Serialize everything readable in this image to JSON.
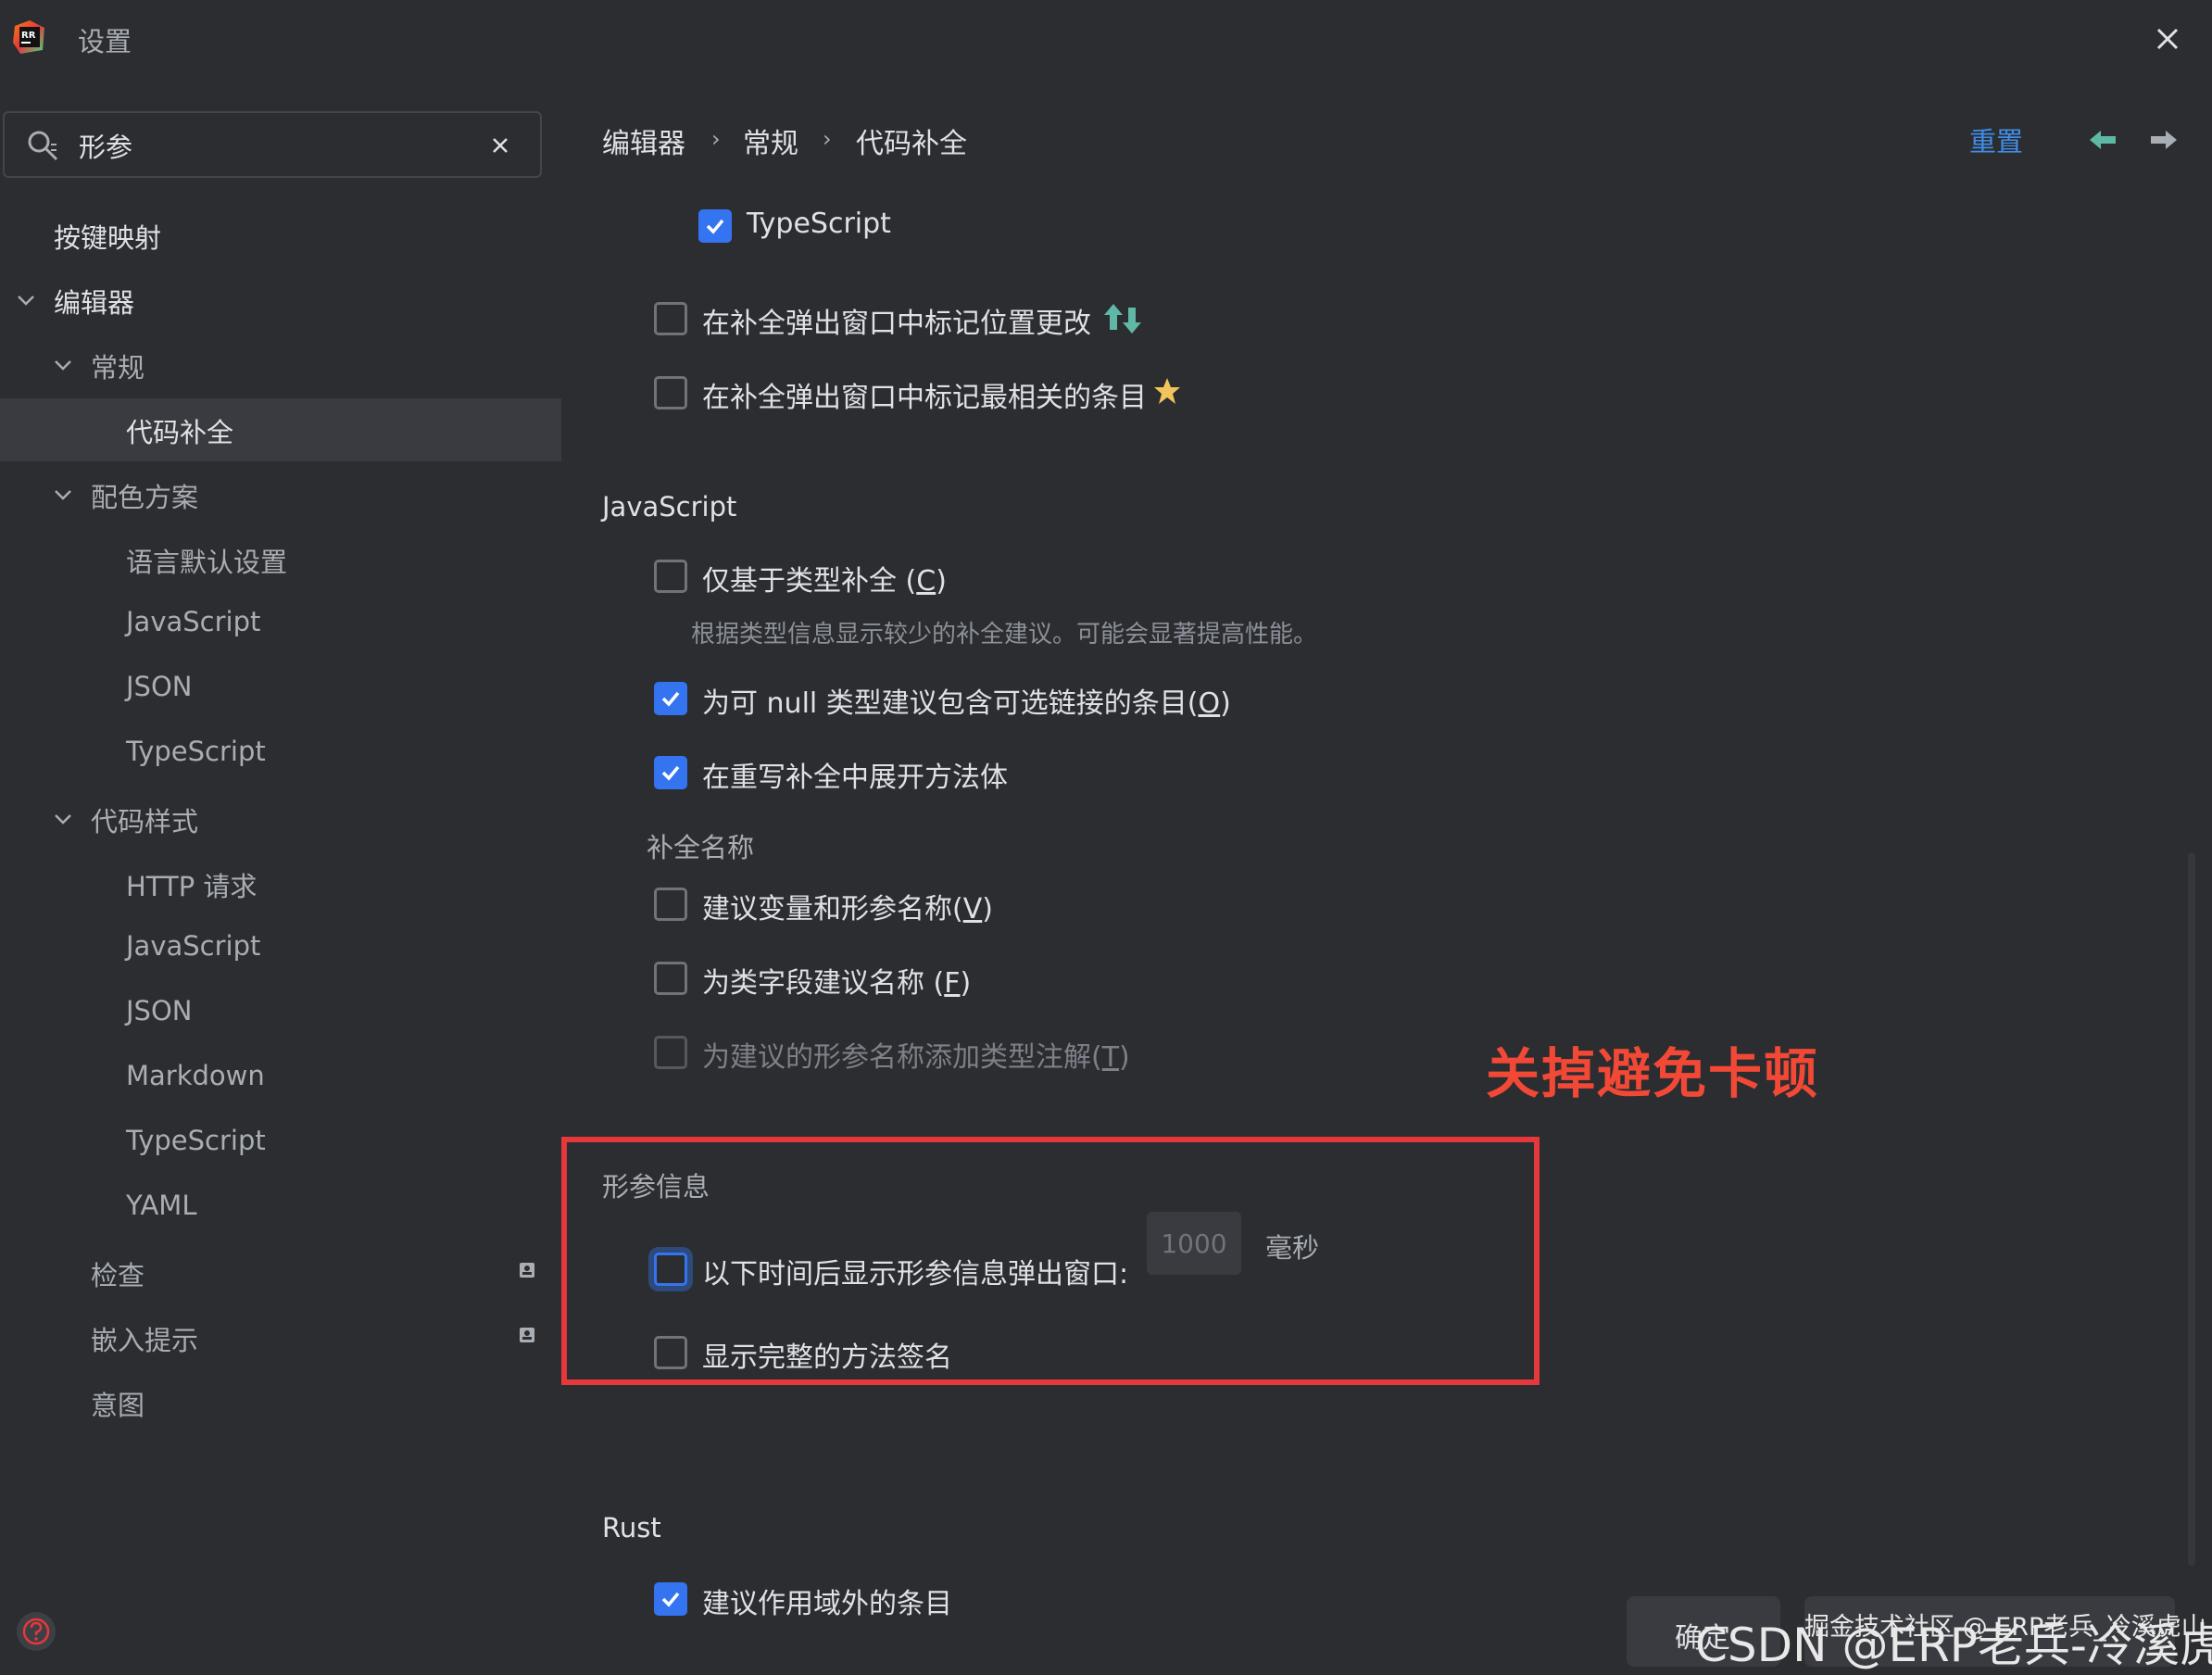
{
  "window": {
    "title": "设置"
  },
  "search": {
    "value": "形参"
  },
  "sidebar": {
    "items": [
      {
        "label": "按键映射"
      },
      {
        "label": "编辑器"
      },
      {
        "label": "常规"
      },
      {
        "label": "代码补全"
      },
      {
        "label": "配色方案"
      },
      {
        "label": "语言默认设置"
      },
      {
        "label": "JavaScript"
      },
      {
        "label": "JSON"
      },
      {
        "label": "TypeScript"
      },
      {
        "label": "代码样式"
      },
      {
        "label": "HTTP 请求"
      },
      {
        "label": "JavaScript"
      },
      {
        "label": "JSON"
      },
      {
        "label": "Markdown"
      },
      {
        "label": "TypeScript"
      },
      {
        "label": "YAML"
      },
      {
        "label": "检查"
      },
      {
        "label": "嵌入提示"
      },
      {
        "label": "意图"
      }
    ]
  },
  "breadcrumb": {
    "items": [
      "编辑器",
      "常规",
      "代码补全"
    ]
  },
  "header": {
    "reset_label": "重置"
  },
  "settings": {
    "typescript_cb": {
      "label": "TypeScript",
      "checked": true
    },
    "mark_position_cb": {
      "label": "在补全弹出窗口中标记位置更改",
      "checked": false
    },
    "mark_relevant_cb": {
      "label": "在补全弹出窗口中标记最相关的条目",
      "checked": false
    },
    "javascript_section": "JavaScript",
    "type_based": {
      "label": "仅基于类型补全 (",
      "mnemonic": "C",
      "suffix": ")",
      "checked": false
    },
    "type_based_hint": "根据类型信息显示较少的补全建议。可能会显著提高性能。",
    "nullable": {
      "label_a": "为可 ",
      "label_null": "null",
      "label_b": " 类型建议包含可选链接的条目(",
      "mnemonic": "O",
      "suffix": ")",
      "checked": true
    },
    "expand_method": {
      "label": "在重写补全中展开方法体",
      "checked": true
    },
    "completion_names_section": "补全名称",
    "suggest_var": {
      "label": "建议变量和形参名称(",
      "mnemonic": "V",
      "suffix": ")",
      "checked": false
    },
    "suggest_field": {
      "label": "为类字段建议名称 (",
      "mnemonic": "F",
      "suffix": ")",
      "checked": false
    },
    "add_type_annot": {
      "label": "为建议的形参名称添加类型注解(",
      "mnemonic": "T",
      "suffix": ")",
      "checked": false,
      "disabled": true
    },
    "param_info_section": "形参信息",
    "show_param_popup": {
      "label": "以下时间后显示形参信息弹出窗口:",
      "checked": false,
      "delay_value": "1000",
      "unit": "毫秒"
    },
    "full_signature": {
      "label": "显示完整的方法签名",
      "checked": false
    },
    "rust_section": "Rust",
    "rust_out_of_scope": {
      "label": "建议作用域外的条目",
      "checked": true
    }
  },
  "annotation": {
    "text": "关掉避免卡顿",
    "color": "#e5383b"
  },
  "footer": {
    "ok_label": "确定"
  },
  "watermarks": {
    "csdn": "CSDN @ERP老兵-冷溪虎山",
    "juejin": "掘金技术社区 @ ERP老兵_冷溪虎山",
    "bg": "ERP老兵-冷溪虎山"
  },
  "colors": {
    "accent": "#3574f0",
    "background": "#2b2d30",
    "selection": "#393b40",
    "link": "#3f8ee8"
  }
}
